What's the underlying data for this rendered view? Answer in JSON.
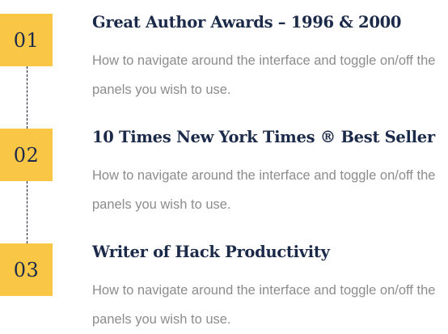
{
  "items": [
    {
      "number": "01",
      "title": "Great Author Awards – 1996 & 2000",
      "description": "How to navigate around the interface and toggle on/off the panels you wish to use."
    },
    {
      "number": "02",
      "title": "10 Times New York Times ® Best Seller",
      "description": "How to navigate around the interface and toggle on/off the panels you wish to use."
    },
    {
      "number": "03",
      "title": "Writer of Hack Productivity",
      "description": "How to navigate around the interface and toggle on/off the panels you wish to use."
    }
  ],
  "colors": {
    "badge": "#f9c646",
    "title": "#1c2a4a",
    "description": "#8c8c8c",
    "connector": "#1a1a2e"
  }
}
